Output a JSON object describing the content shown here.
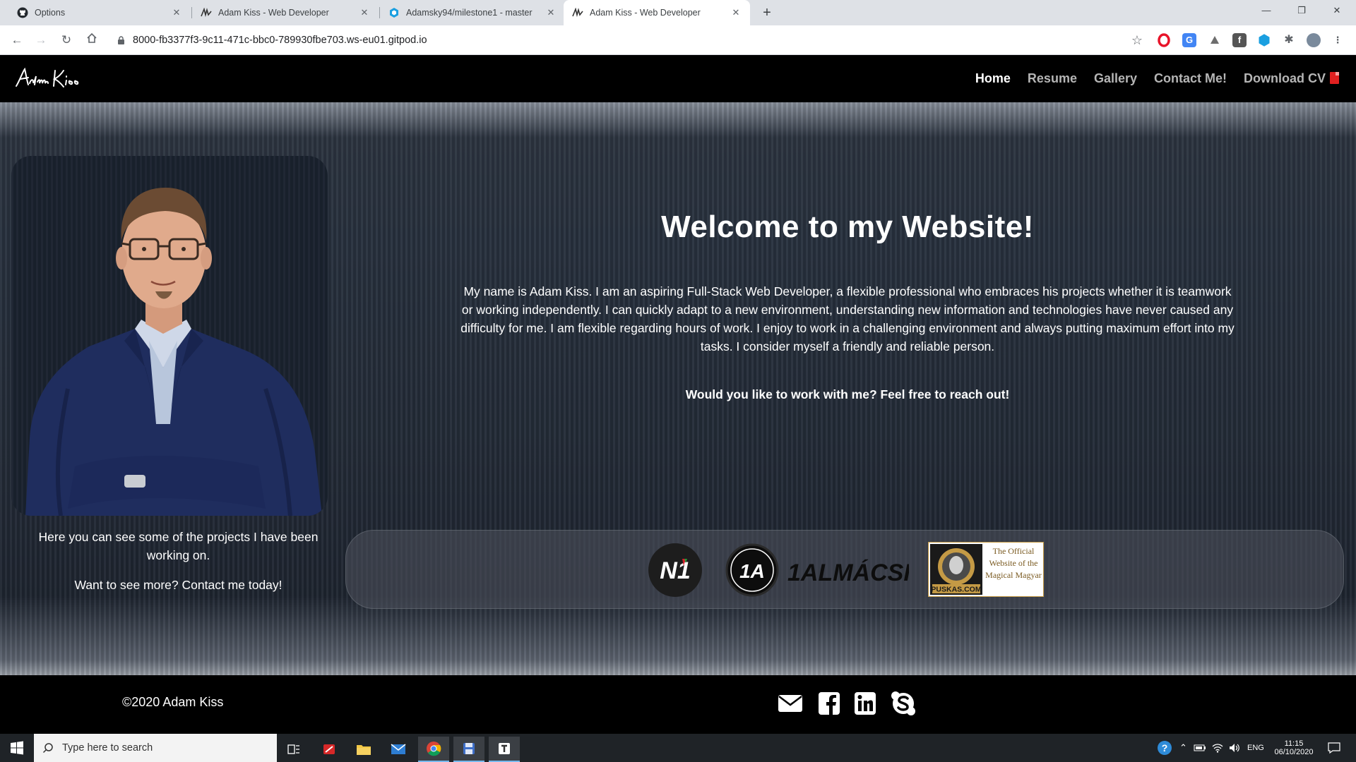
{
  "browser": {
    "tabs": [
      {
        "label": "Options",
        "icon": "github-icon",
        "active": false
      },
      {
        "label": "Adam Kiss - Web Developer",
        "icon": "signature-icon",
        "active": false
      },
      {
        "label": "Adamsky94/milestone1 - master",
        "icon": "gitpod-icon",
        "active": false
      },
      {
        "label": "Adam Kiss - Web Developer",
        "icon": "signature-icon",
        "active": true
      }
    ],
    "new_tab_symbol": "+",
    "url": "8000-fb3377f3-9c11-471c-bbc0-789930fbe703.ws-eu01.gitpod.io"
  },
  "site": {
    "logo_text": "Adam Kiss",
    "nav": [
      {
        "label": "Home",
        "active": true
      },
      {
        "label": "Resume",
        "active": false
      },
      {
        "label": "Gallery",
        "active": false
      },
      {
        "label": "Contact Me!",
        "active": false
      },
      {
        "label": "Download CV",
        "active": false
      }
    ],
    "welcome_title": "Welcome to my Website!",
    "intro_text": "My name is Adam Kiss. I am an aspiring Full-Stack Web Developer, a flexible professional who embraces his projects whether it is teamwork or working independently. I can quickly adapt to a new environment, understanding new information and technologies have never caused any difficulty for me. I am flexible regarding hours of work. I enjoy to work in a challenging environment and always putting maximum effort into my tasks. I consider myself a friendly and reliable person.",
    "cta_text": "Would you like to work with me? Feel free to reach out!",
    "projects_text": "Here you can see some of the projects I have been working on.",
    "contact_text": "Want to see more? Contact me today!",
    "projects": [
      {
        "name": "N1",
        "label": "N1"
      },
      {
        "name": "1A Almacsi",
        "badge": "1A",
        "label": "1ALMÁCSI"
      },
      {
        "name": "Puskas.com",
        "logo": "PUSKAS.COM",
        "caption": "The Official Website of the Magical Magyar"
      }
    ],
    "footer": {
      "copyright": "©2020 Adam Kiss",
      "social": [
        "envelope-icon",
        "facebook-icon",
        "linkedin-icon",
        "skype-icon"
      ]
    }
  },
  "taskbar": {
    "search_placeholder": "Type here to search",
    "language": "ENG",
    "time": "11:15",
    "date": "06/10/2020"
  },
  "colors": {
    "nav_bg": "#000000",
    "hero_bg": "#28313e",
    "accent_red": "#e02020"
  }
}
